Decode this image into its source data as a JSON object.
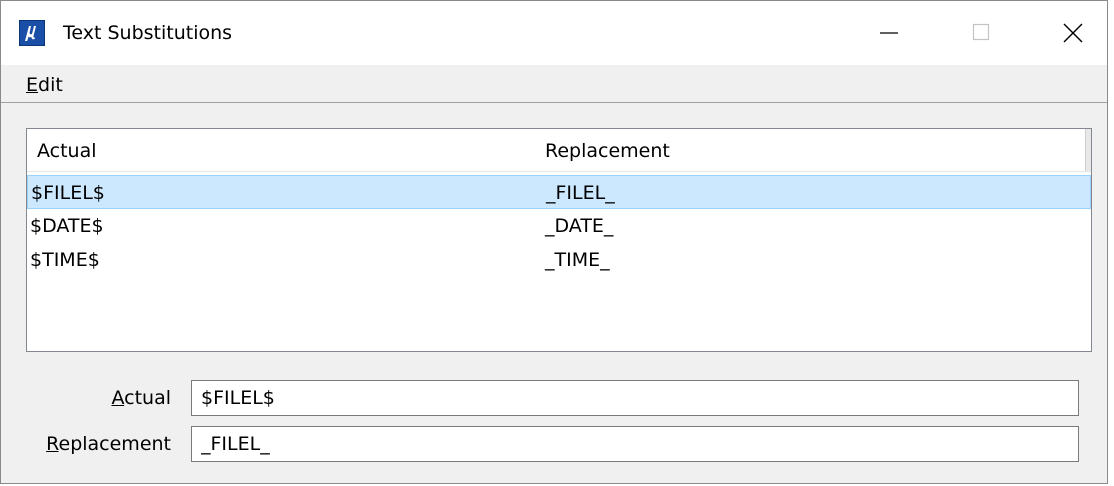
{
  "window": {
    "title": "Text Substitutions",
    "icon": "microstation-app-icon",
    "controls": [
      "minimize-icon",
      "maximize-icon",
      "close-icon"
    ]
  },
  "menubar": {
    "items": [
      {
        "label": "Edit"
      }
    ]
  },
  "table": {
    "columns": [
      "Actual",
      "Replacement"
    ],
    "rows": [
      {
        "actual": "$FILEL$",
        "replacement": "_FILEL_",
        "selected": true
      },
      {
        "actual": "$DATE$",
        "replacement": "_DATE_",
        "selected": false
      },
      {
        "actual": "$TIME$",
        "replacement": "_TIME_",
        "selected": false
      }
    ]
  },
  "form": {
    "actual_label": "Actual",
    "actual_value": "$FILEL$",
    "replacement_label": "Replacement",
    "replacement_value": "_FILEL_"
  },
  "colors": {
    "selection": "#cce8ff",
    "selection_border": "#99d1ff",
    "app_icon": "#1a4fa8"
  }
}
